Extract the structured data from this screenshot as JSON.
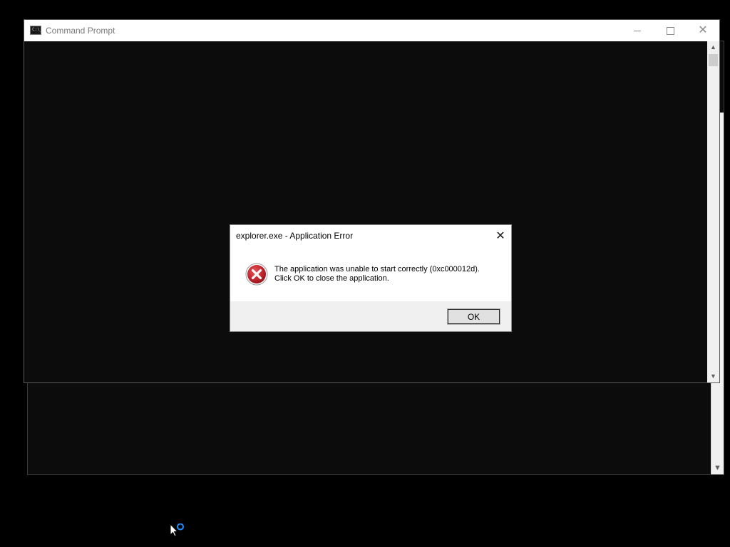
{
  "window": {
    "title": "Command Prompt",
    "icon": "command-prompt-icon",
    "icon_glyph": "C:\\_"
  },
  "title_buttons": {
    "minimize": "minimize-icon",
    "maximize": "maximize-icon",
    "close": "close-icon",
    "close_glyph": "✕"
  },
  "scrollbar": {
    "up_glyph": "▲",
    "down_glyph": "▼"
  },
  "dialog": {
    "title": "explorer.exe - Application Error",
    "close_glyph": "✕",
    "icon": "error-icon",
    "message_line1": "The application was unable to start correctly (0xc000012d).",
    "message_line2": "Click OK to close the application.",
    "ok_label": "OK"
  },
  "colors": {
    "console_bg": "#0c0c0c",
    "error_red": "#c4262e",
    "busy_ring": "#1e90ff"
  }
}
